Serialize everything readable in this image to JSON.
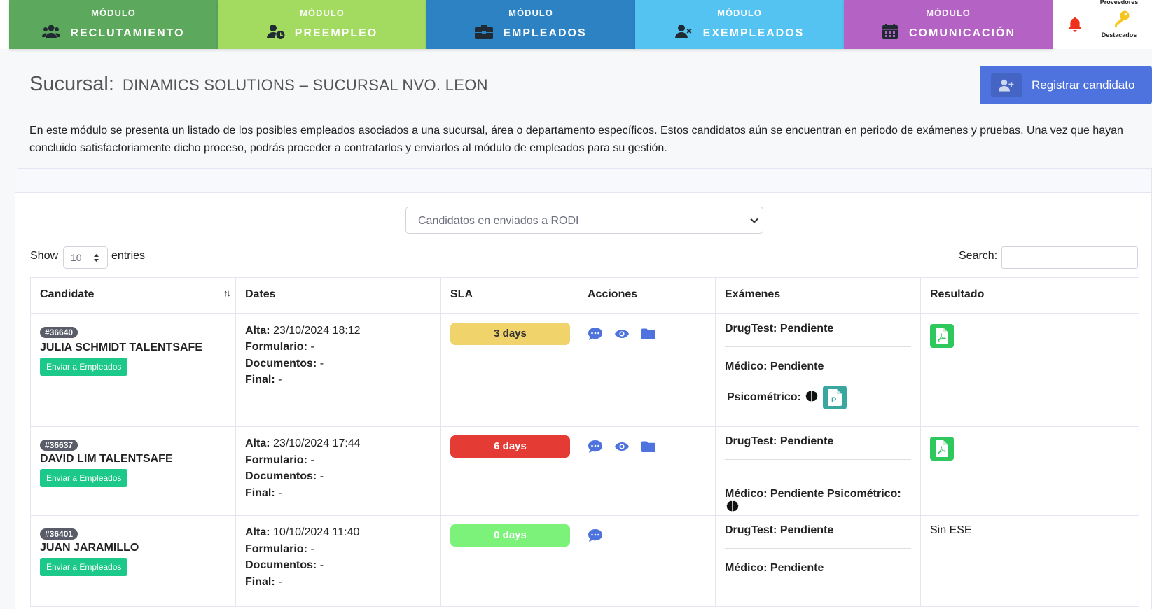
{
  "nav": {
    "kicker": "MÓDULO",
    "modules": [
      {
        "label": "RECLUTAMIENTO",
        "icon": "users-icon",
        "color": "#5ca85c"
      },
      {
        "label": "PREEMPLEO",
        "icon": "user-clock-icon",
        "color": "#a2db60"
      },
      {
        "label": "EMPLEADOS",
        "icon": "briefcase-icon",
        "color": "#2d82c4"
      },
      {
        "label": "EXEMPLEADOS",
        "icon": "user-times-icon",
        "color": "#55c3f1"
      },
      {
        "label": "COMUNICACIÓN",
        "icon": "calendar-icon",
        "color": "#b462c4"
      }
    ],
    "providers_label": "Proveedores",
    "featured_label": "Destacados"
  },
  "header": {
    "branch_label": "Sucursal:",
    "branch_name": "DINAMICS SOLUTIONS – SUCURSAL NVO. LEON",
    "register_button": "Registrar candidato"
  },
  "intro": "En este módulo se presenta un listado de los posibles empleados asociados a una sucursal, área o departamento específicos. Estos candidatos aún se encuentran en periodo de exámenes y pruebas. Una vez que hayan concluido satisfactoriamente dicho proceso, podrás proceder a contratarlos y enviarlos al módulo de empleados para su gestión.",
  "filter": {
    "selected": "Candidatos en enviados a RODI"
  },
  "table_controls": {
    "show": "Show",
    "length": "10",
    "entries": "entries",
    "search": "Search:"
  },
  "columns": [
    "Candidate",
    "Dates",
    "SLA",
    "Acciones",
    "Exámenes",
    "Resultado"
  ],
  "labels": {
    "send_button": "Enviar a Empleados",
    "alta": "Alta:",
    "formulario": "Formulario:",
    "documentos": "Documentos:",
    "final": "Final:",
    "drugtest": "DrugTest:",
    "medico": "Médico:",
    "psicometrico": "Psicométrico:"
  },
  "rows": [
    {
      "id": "#36640",
      "name": "JULIA SCHMIDT TALENTSAFE",
      "alta": "23/10/2024 18:12",
      "formulario": "-",
      "documentos": "-",
      "final": "-",
      "sla": "3 days",
      "sla_color": "#f0d36a",
      "sla_text_color": "#333333",
      "drugtest": "Pendiente",
      "medico": "Pendiente",
      "resultado": ""
    },
    {
      "id": "#36637",
      "name": "DAVID LIM TALENTSAFE",
      "alta": "23/10/2024 17:44",
      "formulario": "-",
      "documentos": "-",
      "final": "-",
      "sla": "6 days",
      "sla_color": "#e53b35",
      "sla_text_color": "#ffffff",
      "drugtest": "Pendiente",
      "medico": "Pendiente",
      "resultado": ""
    },
    {
      "id": "#36401",
      "name": "JUAN JARAMILLO",
      "alta": "10/10/2024 11:40",
      "formulario": "-",
      "documentos": "-",
      "final": "-",
      "sla": "0 days",
      "sla_color": "#7cf27a",
      "sla_text_color": "#ffffff",
      "drugtest": "Pendiente",
      "medico": "Pendiente",
      "resultado": "Sin ESE"
    }
  ]
}
